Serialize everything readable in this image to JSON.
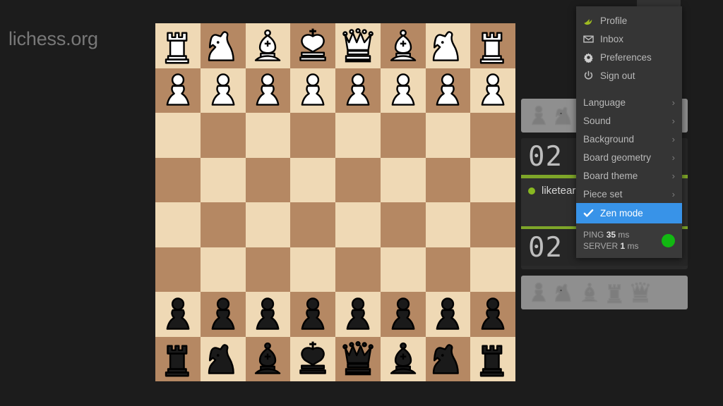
{
  "brand": {
    "text": "lichess.org"
  },
  "colors": {
    "page_bg": "#1c1c1c",
    "board_light": "#EFD9B5",
    "board_dark": "#B58863",
    "menu_bg": "#353535",
    "zen_highlight": "#3893E8",
    "clock_bar_green": "#7EA629",
    "online_green": "#88b821",
    "ping_green": "#12b812"
  },
  "board": {
    "orientation": "white-on-top",
    "light_square": "#EFD9B5",
    "dark_square": "#B58863",
    "rows": [
      [
        "wr",
        "wn",
        "wb",
        "wk",
        "wq",
        "wb",
        "wn",
        "wr"
      ],
      [
        "wp",
        "wp",
        "wp",
        "wp",
        "wp",
        "wp",
        "wp",
        "wp"
      ],
      [
        "",
        "",
        "",
        "",
        "",
        "",
        "",
        ""
      ],
      [
        "",
        "",
        "",
        "",
        "",
        "",
        "",
        ""
      ],
      [
        "",
        "",
        "",
        "",
        "",
        "",
        "",
        ""
      ],
      [
        "",
        "",
        "",
        "",
        "",
        "",
        "",
        ""
      ],
      [
        "bp",
        "bp",
        "bp",
        "bp",
        "bp",
        "bp",
        "bp",
        "bp"
      ],
      [
        "br",
        "bn",
        "bb",
        "bk",
        "bq",
        "bb",
        "bn",
        "br"
      ]
    ]
  },
  "right_panel": {
    "material_top": {
      "pieces": [
        "pawn-icon",
        "knight-icon"
      ]
    },
    "material_bottom": {
      "pieces": [
        "pawn-icon",
        "knight-icon",
        "bishop-icon",
        "rook-icon",
        "queen-icon"
      ]
    },
    "clock_top": "02 :",
    "clock_bottom": "02 :",
    "player": {
      "name": "liketear",
      "status": "online"
    },
    "action_icon": "✖"
  },
  "user_menu": {
    "items": [
      {
        "label": "Profile",
        "icon": "wing-icon",
        "submenu": false,
        "selected": false
      },
      {
        "label": "Inbox",
        "icon": "envelope-icon",
        "submenu": false,
        "selected": false
      },
      {
        "label": "Preferences",
        "icon": "gear-icon",
        "submenu": false,
        "selected": false
      },
      {
        "label": "Sign out",
        "icon": "power-icon",
        "submenu": false,
        "selected": false
      }
    ],
    "settings": [
      {
        "label": "Language",
        "submenu": true,
        "selected": false
      },
      {
        "label": "Sound",
        "submenu": true,
        "selected": false
      },
      {
        "label": "Background",
        "submenu": true,
        "selected": false
      },
      {
        "label": "Board geometry",
        "submenu": true,
        "selected": false
      },
      {
        "label": "Board theme",
        "submenu": true,
        "selected": false
      },
      {
        "label": "Piece set",
        "submenu": true,
        "selected": false
      },
      {
        "label": "Zen mode",
        "submenu": false,
        "selected": true,
        "icon": "check-icon"
      }
    ],
    "chevron": "›",
    "ping": {
      "ping_label": "PING",
      "ping_value": "35",
      "ping_unit": "ms",
      "server_label": "SERVER",
      "server_value": "1",
      "server_unit": "ms",
      "status": "good"
    }
  }
}
